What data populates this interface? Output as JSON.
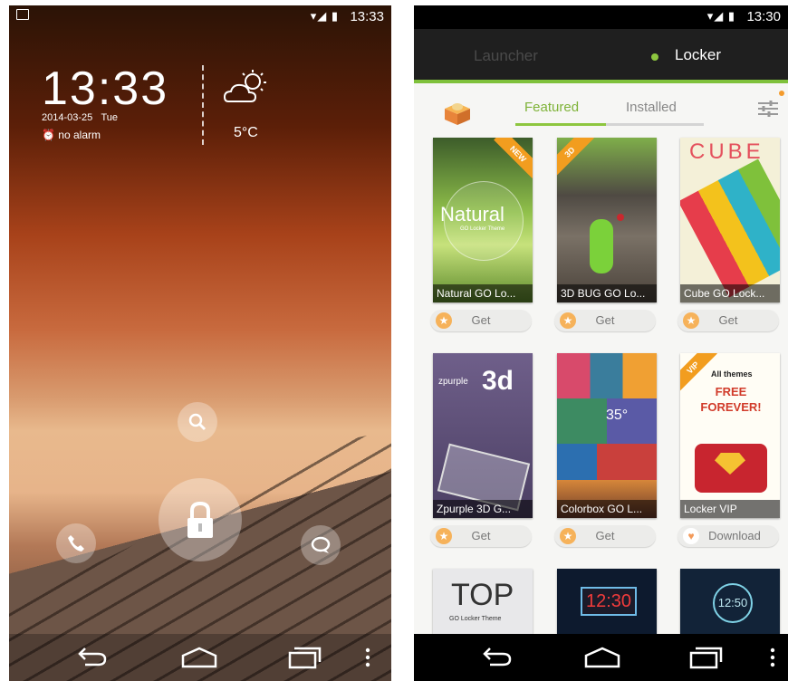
{
  "lock_screen": {
    "status_time": "13:33",
    "clock": "13:33",
    "date": "2014-03-25",
    "weekday": "Tue",
    "alarm": "no alarm",
    "temperature": "5°C"
  },
  "store_screen": {
    "status_time": "13:30",
    "top_tabs": [
      "Launcher",
      "Locker"
    ],
    "sub_tabs": [
      "Featured",
      "Installed"
    ],
    "themes": [
      {
        "name": "Natural GO Lo...",
        "action": "Get",
        "badge": "NEW",
        "art_text": "Natural",
        "art_subtext": "GO Locker Theme"
      },
      {
        "name": "3D BUG GO Lo...",
        "action": "Get",
        "badge": "3D",
        "art_text": "",
        "art_subtext": ""
      },
      {
        "name": "Cube GO Lock...",
        "action": "Get",
        "badge": "",
        "art_text": "CUBE",
        "art_subtext": ""
      },
      {
        "name": "Zpurple 3D  G...",
        "action": "Get",
        "badge": "",
        "art_text": "zpurple",
        "art_subtext": "3d"
      },
      {
        "name": "Colorbox GO L...",
        "action": "Get",
        "badge": "",
        "art_text": "35°",
        "art_subtext": ""
      },
      {
        "name": "Locker VIP",
        "action": "Download",
        "badge": "VIP",
        "art_text": "All themes",
        "art_subtext": "FREE FOREVER!"
      },
      {
        "name": "",
        "action": "",
        "badge": "",
        "art_text": "TOP",
        "art_subtext": "GO Locker Theme"
      },
      {
        "name": "",
        "action": "",
        "badge": "",
        "art_text": "12:30",
        "art_subtext": ""
      },
      {
        "name": "",
        "action": "",
        "badge": "",
        "art_text": "12:50",
        "art_subtext": ""
      }
    ]
  },
  "colors": {
    "accent_green": "#8dc63f",
    "ribbon_orange": "#f29d1f",
    "star_orange": "#f6b25a"
  },
  "icons": [
    "picture-icon",
    "wifi-icon",
    "signal-icon",
    "battery-icon",
    "alarm-icon",
    "weather-icon",
    "search-icon",
    "padlock-icon",
    "phone-icon",
    "message-icon",
    "back-icon",
    "home-icon",
    "recents-icon",
    "menu-icon",
    "theme-box-icon",
    "filter-icon",
    "star-icon",
    "heart-icon"
  ]
}
